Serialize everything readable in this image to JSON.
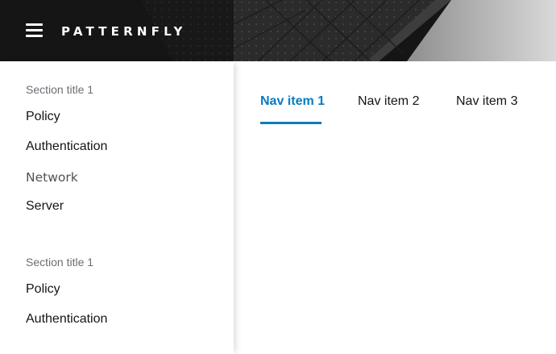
{
  "masthead": {
    "brand": "PATTERNFLY",
    "menu_icon": "hamburger-menu-icon"
  },
  "sidebar": {
    "groups": [
      {
        "title": "Section title 1",
        "items": [
          "Policy",
          "Authentication"
        ]
      },
      {
        "title": "Network",
        "items": [
          "Server"
        ]
      },
      {
        "title": "Section title 1",
        "items": [
          "Policy",
          "Authentication"
        ]
      }
    ]
  },
  "tabs": {
    "items": [
      {
        "label": "Nav item 1",
        "active": true
      },
      {
        "label": "Nav item 2",
        "active": false
      },
      {
        "label": "Nav item 3",
        "active": false
      }
    ]
  },
  "colors": {
    "accent": "#0a7bbf",
    "masthead_bg": "#151515",
    "text": "#151515",
    "muted": "#6a6e73"
  }
}
